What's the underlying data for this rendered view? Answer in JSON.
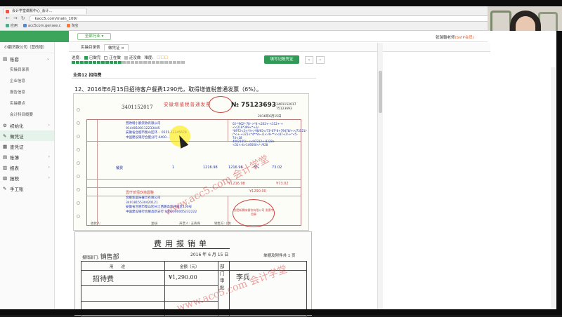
{
  "browser": {
    "tab_title": "会计学堂做账中心_会计...",
    "url": "kacc5.com/main_109/",
    "bookmarks": [
      "应用",
      "acc5com.gensee.c",
      "淘宝"
    ]
  },
  "header": {
    "collapse_icon": "«",
    "industry_label": "全部行业 ▾",
    "teacher_name": "张瑞翰老师",
    "vip_label": "(SVIP会员)"
  },
  "sidebar": {
    "company": "小额贷款公司（营改增）",
    "items": [
      {
        "label": "账套",
        "icon": "book-icon",
        "arrow": "⌄"
      },
      {
        "label": "实操目录表",
        "sub": true
      },
      {
        "label": "企业信息",
        "sub": true
      },
      {
        "label": "报告信息",
        "sub": true
      },
      {
        "label": "实操要点",
        "sub": true
      },
      {
        "label": "会计科目概要",
        "sub": true
      },
      {
        "label": "初始化",
        "icon": "gear-icon",
        "arrow": "›"
      },
      {
        "label": "做凭证",
        "icon": "pen-icon",
        "arrow": ""
      },
      {
        "label": "查凭证",
        "icon": "list-icon",
        "arrow": ""
      },
      {
        "label": "账簿",
        "icon": "book-icon",
        "arrow": "›"
      },
      {
        "label": "报表",
        "icon": "chart-icon",
        "arrow": "›"
      },
      {
        "label": "报税",
        "icon": "doc-icon",
        "arrow": "›"
      },
      {
        "label": "手工账",
        "icon": "pen-icon",
        "arrow": ""
      }
    ]
  },
  "tabs": [
    {
      "label": "实操目录表",
      "active": false
    },
    {
      "label": "做凭证",
      "active": true,
      "close": "×"
    }
  ],
  "progress": {
    "label": "进度:",
    "legend": [
      {
        "label": "已做完",
        "color": "#2f9b57"
      },
      {
        "label": "正在做",
        "color": "#ffffff"
      },
      {
        "label": "还没做",
        "color": "#bbbbbb"
      }
    ],
    "speed_label": "难度:",
    "done_segments": 12,
    "total_segments": 27
  },
  "actions": {
    "enter_voucher": "填写记账凭证",
    "prev": "‹",
    "next": "›"
  },
  "section_title": "业务12 招待费",
  "question": "12、2016年6月15日招待客户餐费1290元，取得增值税普通发票（6%）。",
  "invoice": {
    "code_left": "3401152017",
    "title": "安徽增值税普通发票",
    "no_prefix": "№",
    "number": "75123693",
    "code_right_1": "3401152017",
    "code_right_2": "75123693",
    "date": "2016年6月15日",
    "buyer_lines": [
      "营改增小额贷款有限公司",
      "91440100112233445",
      "安徽省合肥市蜀山区环... 0551-12345678",
      "中国建设银行合肥分行 4400..."
    ],
    "cipher_lines": [
      "02-*962*-78-->*4-<262+-<312+-+<<219*399<*+2/-",
      "*8972<2<*//+/-98/65</73*67*8+79478/+>/73521/-",
      "/*<+-+372<*4**9>-/1<-/9-**<<87+7/-+*<5-74<18",
      "4002165/+<<97312+-8328+<31<-4>149560<*-/928"
    ],
    "item_name": "餐费",
    "item_qty": "1",
    "item_price": "1216.98",
    "item_amount": "1216.98",
    "item_rate": "6%",
    "item_tax": "73.02",
    "sum_amount": "¥1216.98",
    "sum_tax": "¥73.02",
    "total_words": "壹仟贰佰玖拾圆整",
    "total": "¥1290.00",
    "seller_lines": [
      "合肥新晨味餐饮有限公司",
      "340181553042012​1",
      "安徽省合肥市蜀山区长江西路高新开发区100号",
      "中国建设银行合肥高新支行 340000000523222​2"
    ],
    "stamp_text": "合肥新晨味餐饮有限公司 发票专用章",
    "watermark": "www.acc5.com 会计学堂",
    "payee_label": "收款人:",
    "reviewer_label": "复核:",
    "drawer_label": "开票人:",
    "drawer_name": "王燕燕",
    "seller_label": "销售方:",
    "seller_value": "(章)"
  },
  "expense": {
    "title": "费用报销单",
    "dept_label": "报销部门:",
    "dept_value": "销售部",
    "date": "2016 年 6 月 15 日",
    "attachments": "单据及附件共 1 页",
    "col_purpose": "用　　途",
    "col_amount": "金额（元）",
    "purpose_value": "招待费",
    "amount_value": "¥1,290.00",
    "side_text": "部门审批",
    "approver": "李兵",
    "watermark": "www.acc5.com 会计学堂"
  }
}
